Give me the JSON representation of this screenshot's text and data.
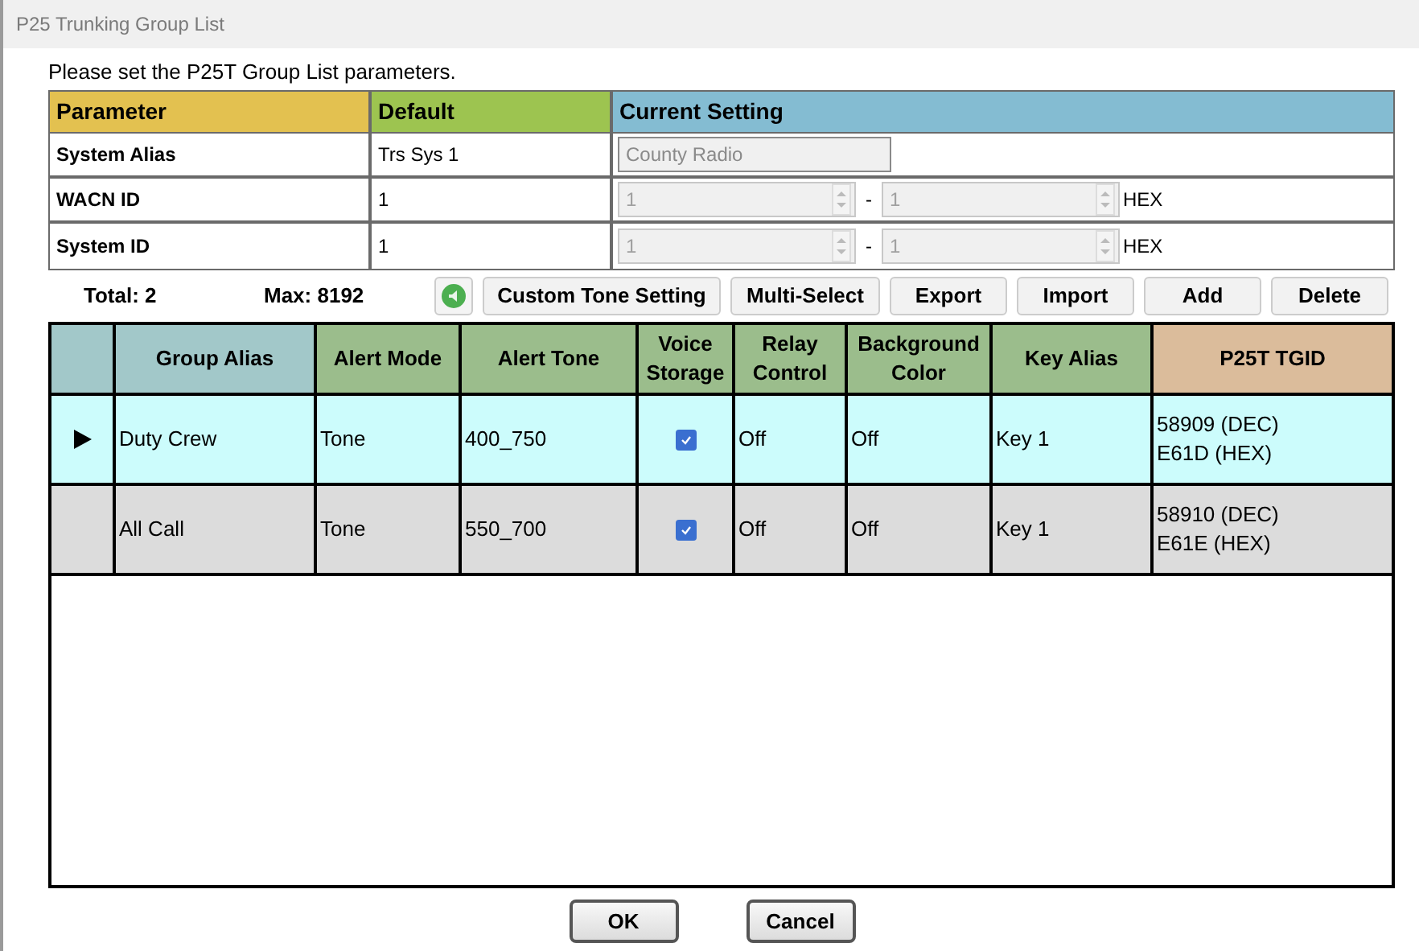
{
  "window": {
    "title": "P25 Trunking Group List"
  },
  "instruction": "Please set the P25T Group List parameters.",
  "params": {
    "columns": [
      "Parameter",
      "Default",
      "Current Setting"
    ],
    "rows": [
      {
        "kind": "text",
        "name": "System Alias",
        "default": "Trs Sys 1",
        "value": "County Radio"
      },
      {
        "kind": "range",
        "name": "WACN ID",
        "default": "1",
        "from": "1",
        "separator": "-",
        "to": "1",
        "unit": "HEX"
      },
      {
        "kind": "range",
        "name": "System ID",
        "default": "1",
        "from": "1",
        "separator": "-",
        "to": "1",
        "unit": "HEX"
      }
    ]
  },
  "toolbar": {
    "total": "Total: 2",
    "max": "Max: 8192",
    "buttons": [
      "Custom Tone Setting",
      "Multi-Select",
      "Export",
      "Import",
      "Add",
      "Delete"
    ]
  },
  "table": {
    "columns": [
      "Group Alias",
      "Alert Mode",
      "Alert Tone",
      "Voice Storage",
      "Relay Control",
      "Background Color",
      "Key Alias",
      "P25T TGID"
    ],
    "rows": [
      {
        "selected": true,
        "group_alias": "Duty Crew",
        "alert_mode": "Tone",
        "alert_tone": "400_750",
        "voice_storage": true,
        "relay_control": "Off",
        "background_color": "Off",
        "key_alias": "Key 1",
        "tgid": [
          "58909 (DEC)",
          "E61D (HEX)"
        ]
      },
      {
        "selected": false,
        "group_alias": "All Call",
        "alert_mode": "Tone",
        "alert_tone": "550_700",
        "voice_storage": true,
        "relay_control": "Off",
        "background_color": "Off",
        "key_alias": "Key 1",
        "tgid": [
          "58910 (DEC)",
          "E61E (HEX)"
        ]
      }
    ]
  },
  "buttons": [
    "OK",
    "Cancel"
  ]
}
